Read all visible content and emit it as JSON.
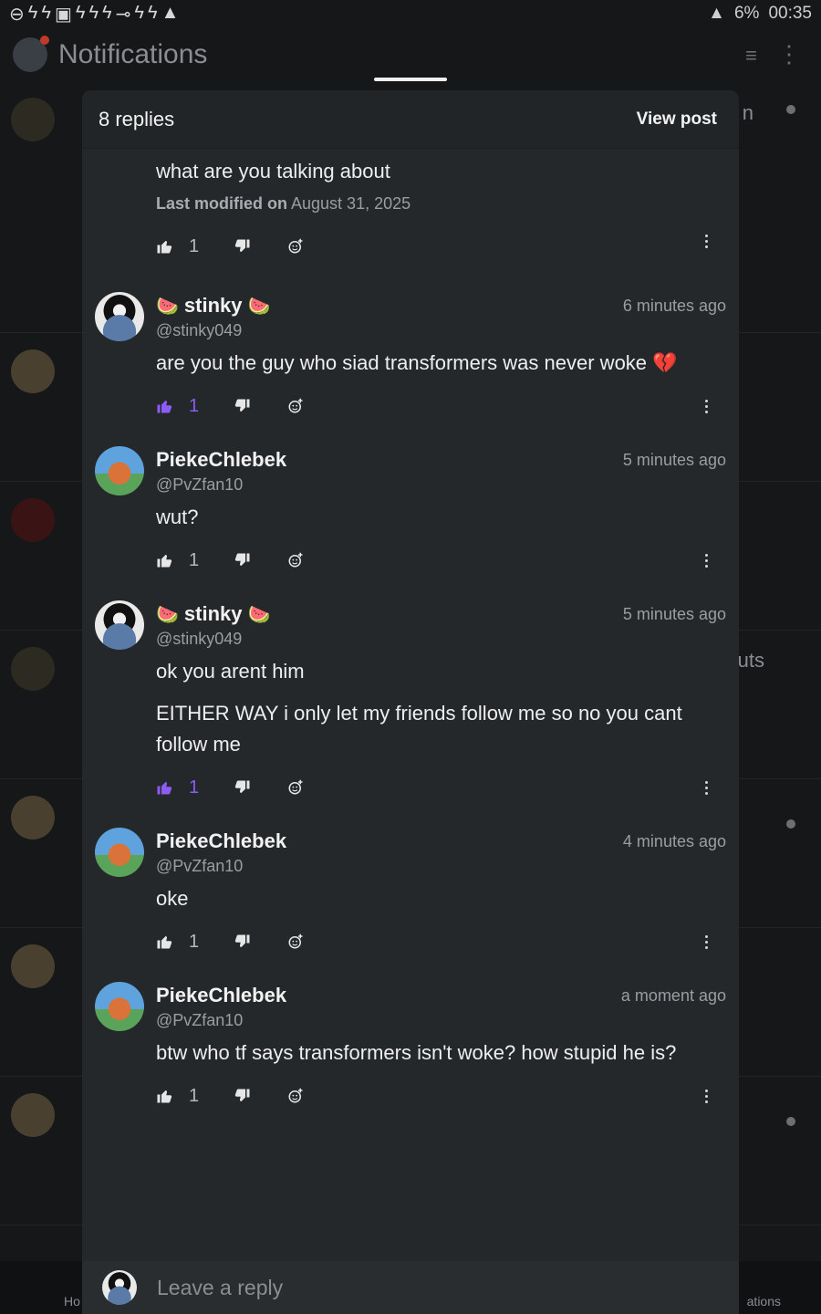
{
  "status_bar": {
    "left_icons": [
      "⊖",
      "ϟ",
      "ϟ",
      "▣",
      "ϟ",
      "ϟ",
      "ϟ",
      "⊸",
      "ϟ",
      "ϟ",
      "▲"
    ],
    "battery": "6%",
    "time": "00:35"
  },
  "background": {
    "title": "Notifications",
    "bottom_nav_left": "Ho",
    "bottom_nav_right": "ations",
    "side_fragments": [
      "n",
      "uts"
    ]
  },
  "sheet": {
    "title": "8 replies",
    "view_post_label": "View post"
  },
  "colors": {
    "accent": "#8b5cf6",
    "sheet_bg": "#25282b"
  },
  "first_reply": {
    "text": "what are you talking about",
    "modified_label": "Last modified on",
    "modified_date": "August 31, 2025",
    "likes": "1"
  },
  "replies": [
    {
      "name": "stinky",
      "handle": "@stinky049",
      "time": "6 minutes ago",
      "paragraphs": [
        "are you the guy who siad transformers was never woke 💔"
      ],
      "likes": "1",
      "liked": true,
      "avatar": "stinky"
    },
    {
      "name": "PiekeChlebek",
      "handle": "@PvZfan10",
      "time": "5 minutes ago",
      "paragraphs": [
        "wut?"
      ],
      "likes": "1",
      "liked": false,
      "avatar": "pieke"
    },
    {
      "name": "stinky",
      "handle": "@stinky049",
      "time": "5 minutes ago",
      "paragraphs": [
        "ok you arent him",
        "EITHER WAY i only let my friends follow me so no you cant follow me"
      ],
      "likes": "1",
      "liked": true,
      "avatar": "stinky"
    },
    {
      "name": "PiekeChlebek",
      "handle": "@PvZfan10",
      "time": "4 minutes ago",
      "paragraphs": [
        "oke"
      ],
      "likes": "1",
      "liked": false,
      "avatar": "pieke"
    },
    {
      "name": "PiekeChlebek",
      "handle": "@PvZfan10",
      "time": "a moment ago",
      "paragraphs": [
        "btw who tf says transformers isn't woke? how stupid he is?"
      ],
      "likes": "1",
      "liked": false,
      "avatar": "pieke"
    }
  ],
  "reply_bar": {
    "placeholder": "Leave a reply"
  }
}
